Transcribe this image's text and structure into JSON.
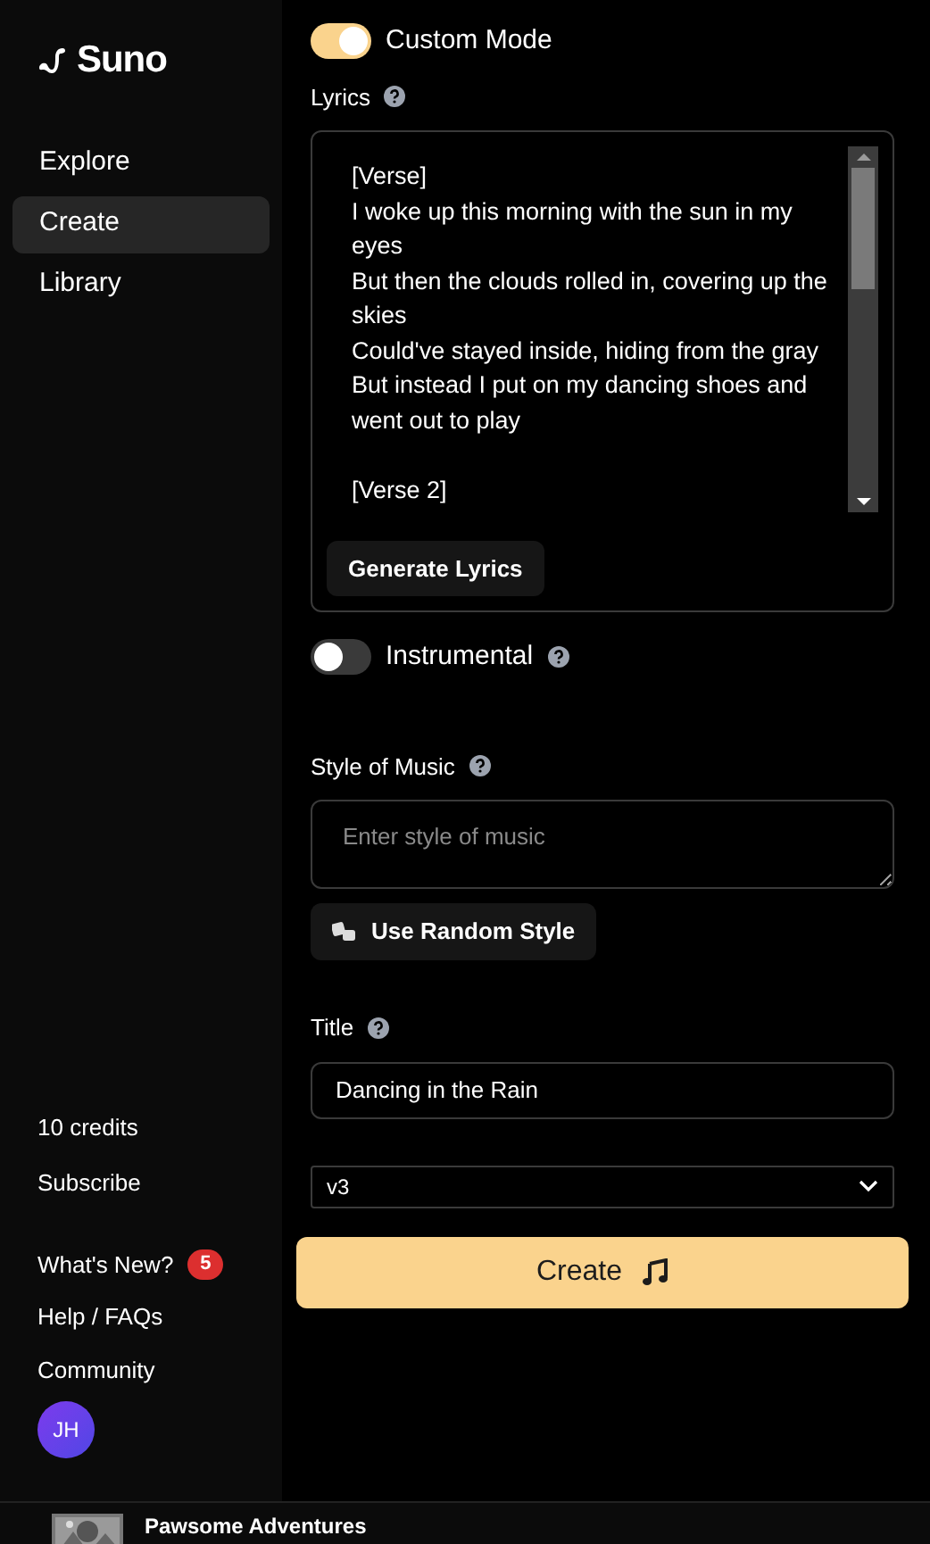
{
  "sidebar": {
    "logo": "Suno",
    "nav": [
      {
        "label": "Explore",
        "selected": false
      },
      {
        "label": "Create",
        "selected": true
      },
      {
        "label": "Library",
        "selected": false
      }
    ],
    "credits": "10 credits",
    "subscribe": "Subscribe",
    "links": [
      {
        "label": "What's New?",
        "badge": "5"
      },
      {
        "label": "Help / FAQs"
      },
      {
        "label": "Community"
      }
    ],
    "avatar": "JH"
  },
  "form": {
    "custom_mode": {
      "label": "Custom Mode",
      "on": true
    },
    "lyrics": {
      "label": "Lyrics",
      "value": "[Verse]\nI woke up this morning with the sun in my eyes\nBut then the clouds rolled in, covering up the skies\nCould've stayed inside, hiding from the gray\nBut instead I put on my dancing shoes and went out to play\n\n[Verse 2]",
      "generate_button": "Generate Lyrics"
    },
    "instrumental": {
      "label": "Instrumental",
      "on": false
    },
    "style": {
      "label": "Style of Music",
      "placeholder": "Enter style of music",
      "random_button": "Use Random Style"
    },
    "title": {
      "label": "Title",
      "value": "Dancing in the Rain"
    },
    "model": {
      "value": "v3"
    },
    "create_button": "Create"
  },
  "player": {
    "track_title": "Pawsome Adventures"
  }
}
